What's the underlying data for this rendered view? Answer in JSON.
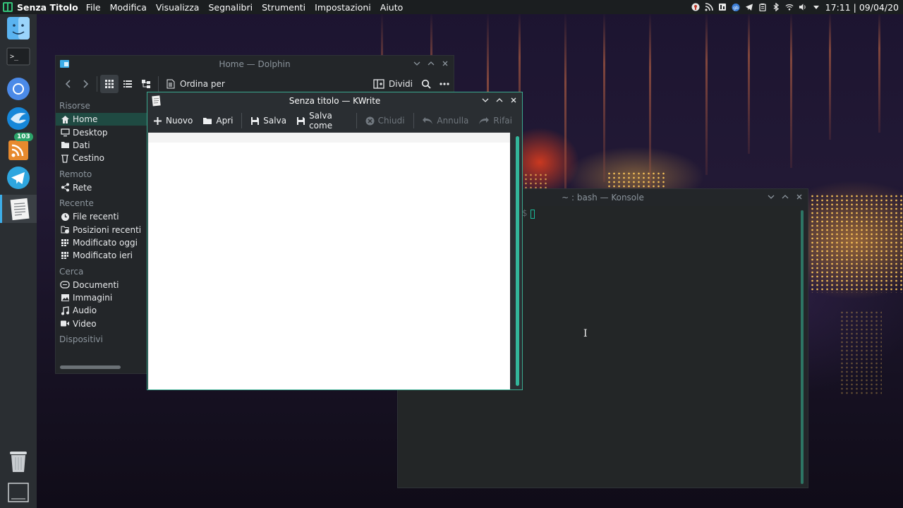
{
  "topbar": {
    "app_name": "Senza Titolo",
    "menu": [
      "File",
      "Modifica",
      "Visualizza",
      "Segnalibri",
      "Strumenti",
      "Impostazioni",
      "Aiuto"
    ],
    "clock": "17:11 | 09/04/20"
  },
  "tray": {
    "icons": [
      "vpn-icon",
      "rss-icon",
      "monitor-icon",
      "network-badge-icon",
      "telegram-icon",
      "clipboard-icon",
      "bluetooth-icon",
      "wifi-icon",
      "volume-icon",
      "chevron-down-icon"
    ],
    "network_badge_text": "gb"
  },
  "dock": {
    "items": [
      "finder-icon",
      "terminal-icon",
      "chromium-icon",
      "thunderbird-icon",
      "rss-reader-icon",
      "telegram-icon",
      "kwrite-icon"
    ],
    "rss_badge": "103",
    "terminal_glyph": ">_",
    "bottom": [
      "trash-icon",
      "desktop-icon"
    ]
  },
  "dolphin": {
    "title": "Home — Dolphin",
    "toolbar": {
      "sort_label": "Ordina per",
      "split_label": "Dividi"
    },
    "places": {
      "sections": [
        {
          "label": "Risorse",
          "items": [
            {
              "label": "Home",
              "icon": "home-icon",
              "selected": true
            },
            {
              "label": "Desktop",
              "icon": "desktop-icon"
            },
            {
              "label": "Dati",
              "icon": "folder-icon"
            },
            {
              "label": "Cestino",
              "icon": "trash-icon"
            }
          ]
        },
        {
          "label": "Remoto",
          "items": [
            {
              "label": "Rete",
              "icon": "network-icon"
            }
          ]
        },
        {
          "label": "Recente",
          "items": [
            {
              "label": "File recenti",
              "icon": "clock-icon"
            },
            {
              "label": "Posizioni recenti",
              "icon": "recent-places-icon"
            },
            {
              "label": "Modificato oggi",
              "icon": "calendar-icon"
            },
            {
              "label": "Modificato ieri",
              "icon": "calendar-icon"
            }
          ]
        },
        {
          "label": "Cerca",
          "items": [
            {
              "label": "Documenti",
              "icon": "document-icon"
            },
            {
              "label": "Immagini",
              "icon": "image-icon"
            },
            {
              "label": "Audio",
              "icon": "music-icon"
            },
            {
              "label": "Video",
              "icon": "video-icon"
            }
          ]
        },
        {
          "label": "Dispositivi",
          "items": []
        }
      ]
    }
  },
  "kwrite": {
    "title": "Senza titolo — KWrite",
    "toolbar": {
      "new": "Nuovo",
      "open": "Apri",
      "save": "Salva",
      "save_as": "Salva come",
      "close": "Chiudi",
      "undo": "Annulla",
      "redo": "Rifai"
    }
  },
  "konsole": {
    "title": "~ : bash — Konsole",
    "prompt_tail": "$"
  },
  "colors": {
    "accent": "#3aa98f",
    "selection": "#1f4a42",
    "panel": "#1b1e20",
    "window": "#232629"
  }
}
